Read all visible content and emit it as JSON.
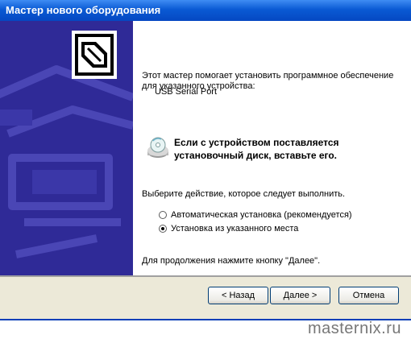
{
  "window": {
    "title": "Мастер нового оборудования"
  },
  "content": {
    "intro": "Этот мастер помогает установить программное обеспечение для указанного устройства:",
    "device_name": "USB Serial Port",
    "insert_disk": "Если с устройством поставляется установочный диск, вставьте его.",
    "choose_action": "Выберите действие, которое следует выполнить.",
    "options": [
      {
        "label": "Автоматическая установка (рекомендуется)",
        "selected": false
      },
      {
        "label": "Установка из указанного места",
        "selected": true
      }
    ],
    "continue_hint": "Для продолжения нажмите кнопку \"Далее\"."
  },
  "buttons": {
    "back": "< Назад",
    "next": "Далее >",
    "cancel": "Отмена"
  },
  "watermark": "masternix.ru",
  "colors": {
    "titlebar": "#0a5ad4",
    "sidebar": "#2f2a97",
    "buttonbar": "#ece9d8"
  }
}
